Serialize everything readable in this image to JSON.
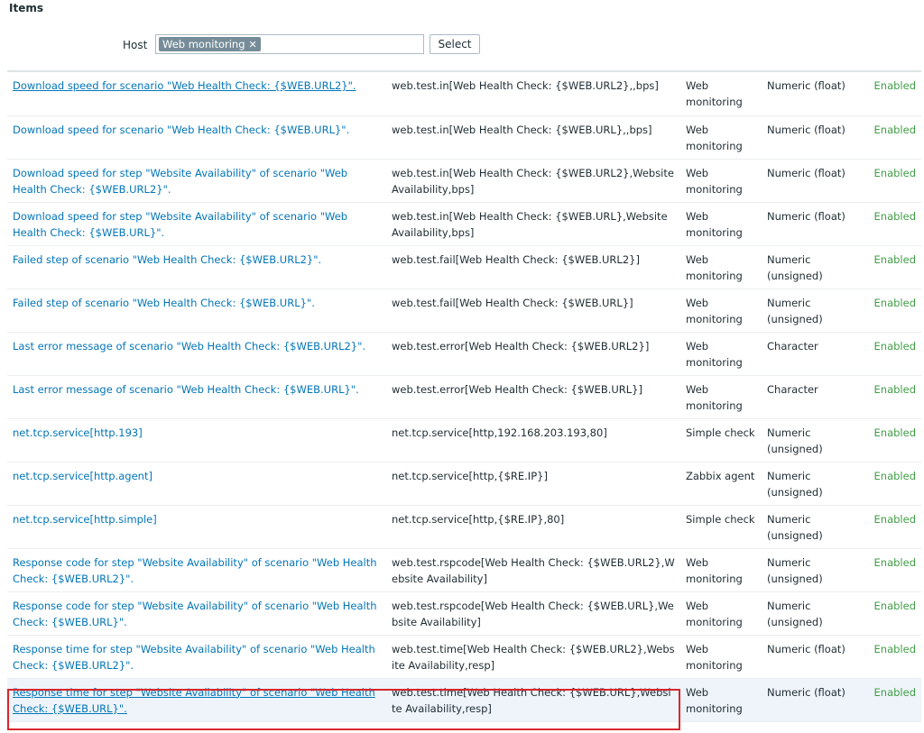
{
  "page": {
    "title": "Items"
  },
  "filter": {
    "host_label": "Host",
    "host_chip": "Web monitoring",
    "chip_remove": "✕",
    "select_label": "Select"
  },
  "rows": [
    {
      "name": "Download speed for scenario \"Web Health Check: {$WEB.URL2}\".",
      "key": "web.test.in[Web Health Check: {$WEB.URL2},,bps]",
      "type": "Web monitoring",
      "info": "Numeric (float)",
      "status": "Enabled"
    },
    {
      "name": "Download speed for scenario \"Web Health Check: {$WEB.URL}\".",
      "key": "web.test.in[Web Health Check: {$WEB.URL},,bps]",
      "type": "Web monitoring",
      "info": "Numeric (float)",
      "status": "Enabled"
    },
    {
      "name": "Download speed for step \"Website Availability\" of scenario \"Web Health Check: {$WEB.URL2}\".",
      "key": "web.test.in[Web Health Check: {$WEB.URL2},Website Availability,bps]",
      "type": "Web monitoring",
      "info": "Numeric (float)",
      "status": "Enabled"
    },
    {
      "name": "Download speed for step \"Website Availability\" of scenario \"Web Health Check: {$WEB.URL}\".",
      "key": "web.test.in[Web Health Check: {$WEB.URL},Website Availability,bps]",
      "type": "Web monitoring",
      "info": "Numeric (float)",
      "status": "Enabled"
    },
    {
      "name": "Failed step of scenario \"Web Health Check: {$WEB.URL2}\".",
      "key": "web.test.fail[Web Health Check: {$WEB.URL2}]",
      "type": "Web monitoring",
      "info": "Numeric (unsigned)",
      "status": "Enabled"
    },
    {
      "name": "Failed step of scenario \"Web Health Check: {$WEB.URL}\".",
      "key": "web.test.fail[Web Health Check: {$WEB.URL}]",
      "type": "Web monitoring",
      "info": "Numeric (unsigned)",
      "status": "Enabled"
    },
    {
      "name": "Last error message of scenario \"Web Health Check: {$WEB.URL2}\".",
      "key": "web.test.error[Web Health Check: {$WEB.URL2}]",
      "type": "Web monitoring",
      "info": "Character",
      "status": "Enabled"
    },
    {
      "name": "Last error message of scenario \"Web Health Check: {$WEB.URL}\".",
      "key": "web.test.error[Web Health Check: {$WEB.URL}]",
      "type": "Web monitoring",
      "info": "Character",
      "status": "Enabled"
    },
    {
      "name": "net.tcp.service[http.193]",
      "key": "net.tcp.service[http,192.168.203.193,80]",
      "type": "Simple check",
      "info": "Numeric (unsigned)",
      "status": "Enabled"
    },
    {
      "name": "net.tcp.service[http.agent]",
      "key": "net.tcp.service[http,{$RE.IP}]",
      "type": "Zabbix agent",
      "info": "Numeric (unsigned)",
      "status": "Enabled"
    },
    {
      "name": "net.tcp.service[http.simple]",
      "key": "net.tcp.service[http,{$RE.IP},80]",
      "type": "Simple check",
      "info": "Numeric (unsigned)",
      "status": "Enabled"
    },
    {
      "name": "Response code for step \"Website Availability\" of scenario \"Web Health Check: {$WEB.URL2}\".",
      "key": "web.test.rspcode[Web Health Check: {$WEB.URL2},Website Availability]",
      "type": "Web monitoring",
      "info": "Numeric (unsigned)",
      "status": "Enabled"
    },
    {
      "name": "Response code for step \"Website Availability\" of scenario \"Web Health Check: {$WEB.URL}\".",
      "key": "web.test.rspcode[Web Health Check: {$WEB.URL},Website Availability]",
      "type": "Web monitoring",
      "info": "Numeric (unsigned)",
      "status": "Enabled"
    },
    {
      "name": "Response time for step \"Website Availability\" of scenario \"Web Health Check: {$WEB.URL2}\".",
      "key": "web.test.time[Web Health Check: {$WEB.URL2},Website Availability,resp]",
      "type": "Web monitoring",
      "info": "Numeric (float)",
      "status": "Enabled"
    },
    {
      "name": "Response time for step \"Website Availability\" of scenario \"Web Health Check: {$WEB.URL}\".",
      "key": "web.test.time[Web Health Check: {$WEB.URL},Website Availability,resp]",
      "type": "Web monitoring",
      "info": "Numeric (float)",
      "status": "Enabled"
    }
  ]
}
